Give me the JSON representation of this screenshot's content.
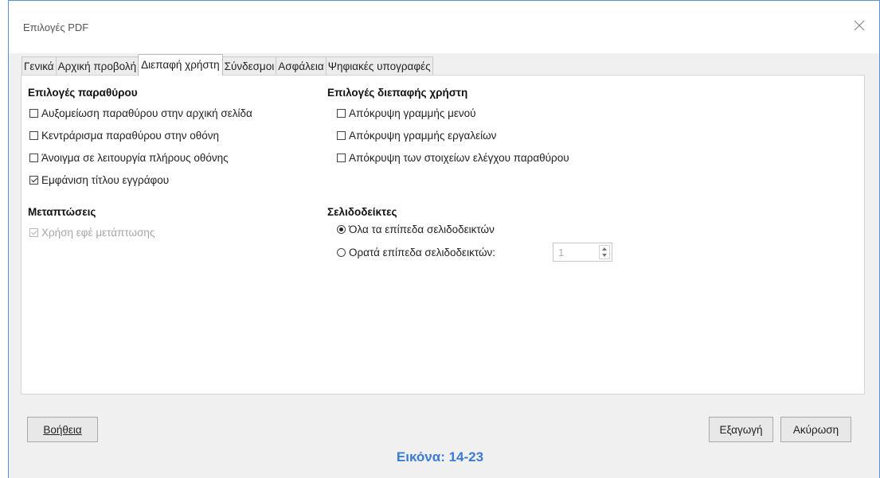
{
  "window": {
    "title": "Επιλογές PDF"
  },
  "tabs": [
    {
      "label": "Γενικά",
      "active": false
    },
    {
      "label": "Αρχική προβολή",
      "active": false
    },
    {
      "label": "Διεπαφή χρήστη",
      "active": true
    },
    {
      "label": "Σύνδεσμοι",
      "active": false
    },
    {
      "label": "Ασφάλεια",
      "active": false
    },
    {
      "label": "Ψηφιακές υπογραφές",
      "active": false
    }
  ],
  "window_options": {
    "title": "Επιλογές παραθύρου",
    "items": [
      {
        "label": "Αυξομείωση παραθύρου στην αρχική σελίδα",
        "checked": false
      },
      {
        "label": "Κεντράρισμα παραθύρου στην οθόνη",
        "checked": false
      },
      {
        "label": "Άνοιγμα σε λειτουργία πλήρους οθόνης",
        "checked": false
      },
      {
        "label": "Εμφάνιση τίτλου εγγράφου",
        "checked": true
      }
    ]
  },
  "ui_options": {
    "title": "Επιλογές διεπαφής χρήστη",
    "items": [
      {
        "label": "Απόκρυψη γραμμής μενού",
        "checked": false
      },
      {
        "label": "Απόκρυψη γραμμής εργαλείων",
        "checked": false
      },
      {
        "label": "Απόκρυψη των στοιχείων ελέγχου παραθύρου",
        "checked": false
      }
    ]
  },
  "transitions": {
    "title": "Μεταπτώσεις",
    "use_transition": {
      "label": "Χρήση εφέ μετάπτωσης",
      "checked": true,
      "enabled": false
    }
  },
  "bookmarks": {
    "title": "Σελιδοδείκτες",
    "all_levels": {
      "label": "Όλα τα επίπεδα σελιδοδεικτών",
      "selected": true
    },
    "visible_levels": {
      "label": "Ορατά επίπεδα σελιδοδεικτών:",
      "selected": false
    },
    "level_value": "1"
  },
  "buttons": {
    "help": "Βοήθεια",
    "export": "Εξαγωγή",
    "cancel": "Ακύρωση"
  },
  "caption": "Εικόνα: 14-23",
  "colors": {
    "accent": "#3a7bd5",
    "border": "#5b8fd6",
    "dialog_bg": "#f0f0f0"
  }
}
